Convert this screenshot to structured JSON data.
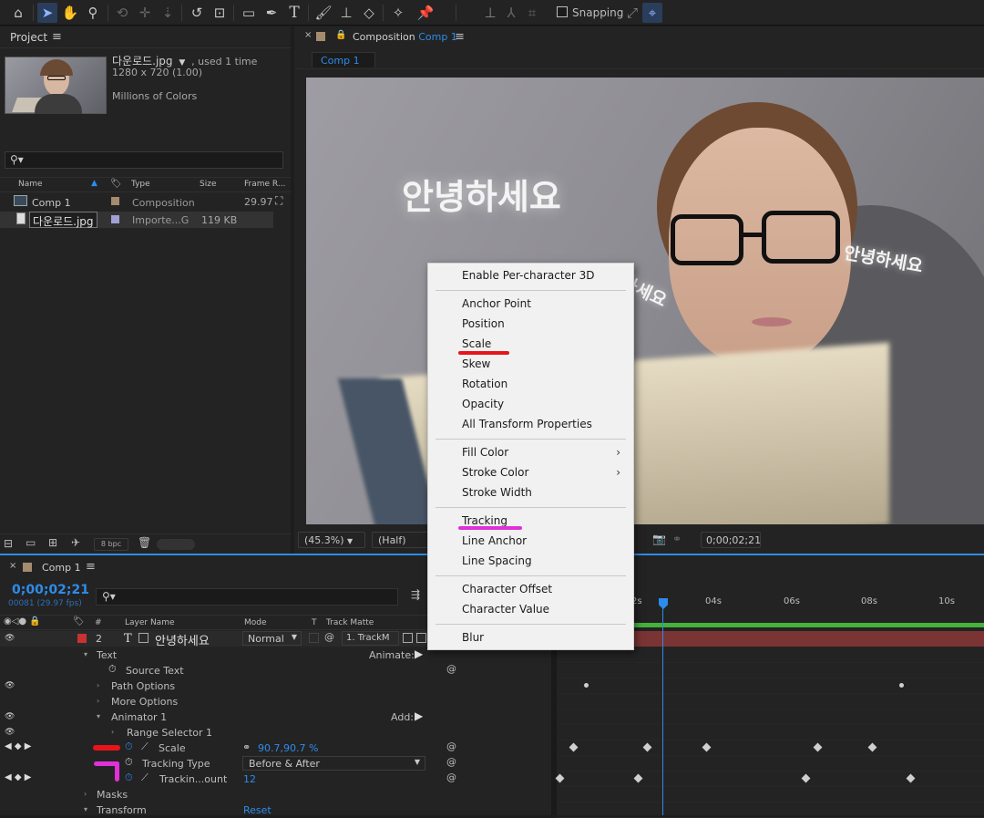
{
  "toolbar": {
    "icons": [
      "home-icon",
      "selection-arrow-icon",
      "hand-icon",
      "zoom-icon",
      "rotate-camera-icon",
      "pan-camera-icon",
      "dolly-camera-icon",
      "rotation-tool-icon",
      "pan-behind-icon",
      "rectangle-tool-icon",
      "pen-tool-icon",
      "type-tool-icon",
      "brush-icon",
      "clone-stamp-icon",
      "eraser-icon",
      "roto-brush-icon",
      "puppet-pin-icon",
      "local-axis-icon",
      "world-axis-icon",
      "view-axis-icon"
    ],
    "snapping_label": "Snapping"
  },
  "project": {
    "title": "Project",
    "file_name": "다운로드.jpg",
    "used": ", used 1 time",
    "dimensions": "1280 x 720 (1.00)",
    "colors": "Millions of Colors",
    "search_placeholder": "",
    "columns": [
      "Name",
      "Type",
      "Size",
      "Frame R..."
    ],
    "items": [
      {
        "name": "Comp 1",
        "type": "Composition",
        "size": "",
        "fps": "29.97"
      },
      {
        "name": "다운로드.jpg",
        "type": "Importe...G",
        "size": "119 KB",
        "fps": ""
      }
    ],
    "bpc": "8 bpc"
  },
  "composition": {
    "title_prefix": "Composition",
    "title_comp": "Comp 1",
    "tab": "Comp 1",
    "text_main": "안녕하세요",
    "text_right": "안녕하세요",
    "text_left": "하세요",
    "zoom": "(45.3%)",
    "resolution": "(Half)",
    "timecode": "0;00;02;21"
  },
  "context_menu": {
    "items": [
      {
        "label": "Enable Per-character 3D",
        "submenu": false
      },
      {
        "label": "Anchor Point",
        "submenu": false
      },
      {
        "label": "Position",
        "submenu": false
      },
      {
        "label": "Scale",
        "submenu": false
      },
      {
        "label": "Skew",
        "submenu": false
      },
      {
        "label": "Rotation",
        "submenu": false
      },
      {
        "label": "Opacity",
        "submenu": false
      },
      {
        "label": "All Transform Properties",
        "submenu": false
      },
      {
        "label": "Fill Color",
        "submenu": true
      },
      {
        "label": "Stroke Color",
        "submenu": true
      },
      {
        "label": "Stroke Width",
        "submenu": false
      },
      {
        "label": "Tracking",
        "submenu": false
      },
      {
        "label": "Line Anchor",
        "submenu": false
      },
      {
        "label": "Line Spacing",
        "submenu": false
      },
      {
        "label": "Character Offset",
        "submenu": false
      },
      {
        "label": "Character Value",
        "submenu": false
      },
      {
        "label": "Blur",
        "submenu": false
      }
    ]
  },
  "timeline": {
    "tab": "Comp 1",
    "timecode": "0;00;02;21",
    "frame_info": "00081 (29.97 fps)",
    "columns": {
      "num": "#",
      "layer_name": "Layer Name",
      "mode": "Mode",
      "t": "T",
      "track_matte": "Track Matte"
    },
    "ruler": [
      "2s",
      "04s",
      "06s",
      "08s",
      "10s"
    ],
    "layer": {
      "number": "2",
      "name": "안녕하세요",
      "mode": "Normal",
      "matte": "1. TrackM"
    },
    "props": {
      "text": "Text",
      "animate": "Animate:",
      "source_text": "Source Text",
      "path_options": "Path Options",
      "more_options": "More Options",
      "animator": "Animator 1",
      "add": "Add:",
      "range_selector": "Range Selector 1",
      "scale": "Scale",
      "scale_value": "90.7,90.7 %",
      "tracking_type": "Tracking Type",
      "tracking_type_value": "Before & After",
      "tracking_amount": "Trackin...ount",
      "tracking_amount_value": "12",
      "masks": "Masks",
      "transform": "Transform",
      "reset": "Reset"
    }
  },
  "colors": {
    "accent_blue": "#2d8ceb",
    "annotation_red": "#e8141a",
    "annotation_magenta": "#e030d8",
    "label_red": "#c83232",
    "label_tan": "#a58c6e",
    "label_lavender": "#a0a0d2",
    "layer_bar": "#7a3434",
    "work_area": "#44b33c"
  }
}
